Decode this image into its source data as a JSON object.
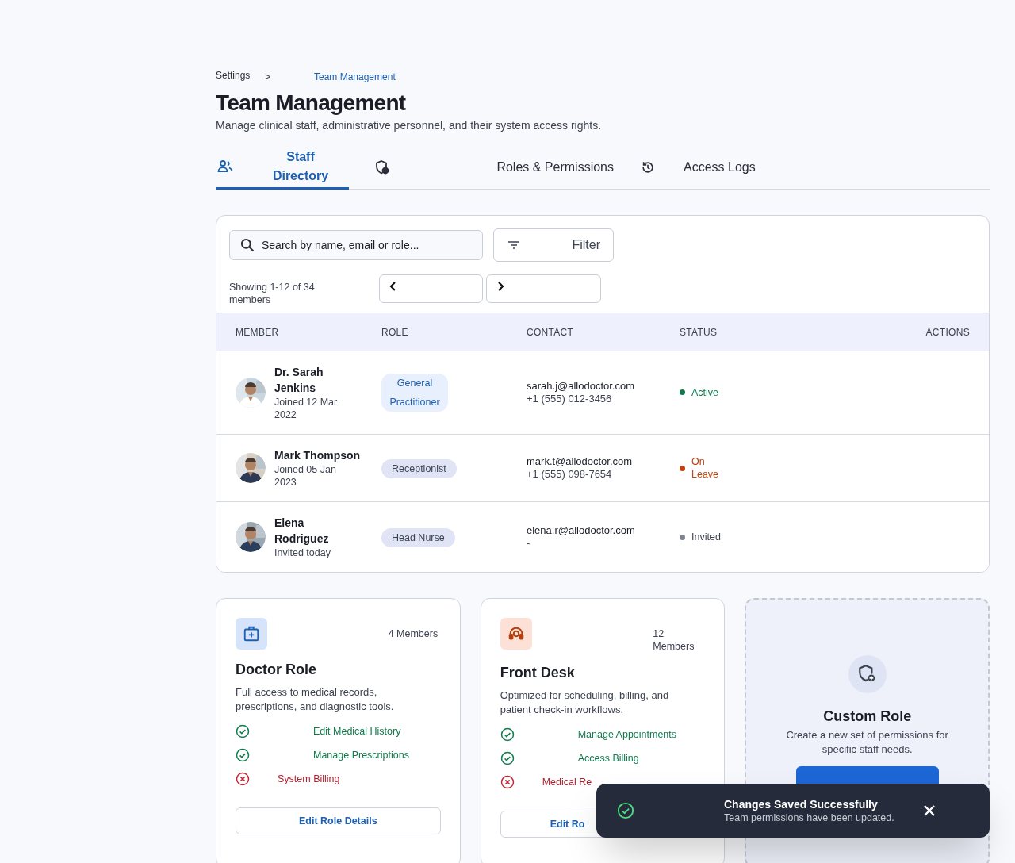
{
  "breadcrumb": {
    "items": [
      {
        "label": "Settings",
        "current": false
      },
      {
        "label": "Team Management",
        "current": true
      }
    ],
    "separator": ">"
  },
  "page": {
    "title": "Team Management",
    "subtitle": "Manage clinical staff, administrative personnel, and their system access rights."
  },
  "tabs": [
    {
      "label": "Staff Directory",
      "selected": true,
      "kind": "people"
    },
    {
      "label": "Roles & Permissions",
      "selected": false,
      "kind": "shield"
    },
    {
      "label": "Access Logs",
      "selected": false,
      "kind": "history"
    }
  ],
  "toolbar": {
    "search": {
      "placeholder": "Search by name, email or role..."
    },
    "filter_label": "Filter",
    "showing": "Showing 1-12 of 34 members"
  },
  "table": {
    "columns": [
      "MEMBER",
      "ROLE",
      "CONTACT",
      "STATUS",
      "ACTIONS"
    ],
    "rows": [
      {
        "name": "Dr. Sarah Jenkins",
        "joined": "Joined 12 Mar 2022",
        "role": "General Practitioner",
        "kind": "primary",
        "email": "sarah.j@allodoctor.com",
        "phone": "+1 (555) 012-3456",
        "status": "Active",
        "color": "#0f7a4b"
      },
      {
        "name": "Mark Thompson",
        "joined": "Joined 05 Jan 2023",
        "role": "Receptionist",
        "kind": "neutral",
        "email": "mark.t@allodoctor.com",
        "phone": "+1 (555) 098-7654",
        "status": "On Leave",
        "color": "#c2410c"
      },
      {
        "name": "Elena Rodriguez",
        "joined": "Invited today",
        "role": "Head Nurse",
        "kind": "neutral",
        "email": "elena.r@allodoctor.com",
        "phone": "-",
        "status": "Invited",
        "color": "#80848f"
      }
    ]
  },
  "role_cards": [
    {
      "kind": "doctor",
      "title": "Doctor Role",
      "members": "4 Members",
      "description": "Full access to medical records, prescriptions, and diagnostic tools.",
      "permissions": [
        {
          "label": "Edit Medical History",
          "granted": true
        },
        {
          "label": "Manage Prescriptions",
          "granted": true
        },
        {
          "label": "System Billing",
          "granted": false
        }
      ],
      "button": "Edit Role Details"
    },
    {
      "kind": "desk",
      "title": "Front Desk",
      "members": "12 Members",
      "description": "Optimized for scheduling, billing, and patient check-in workflows.",
      "permissions": [
        {
          "label": "Manage Appointments",
          "granted": true
        },
        {
          "label": "Access Billing",
          "granted": true
        },
        {
          "label": "Medical Re",
          "granted": false
        }
      ],
      "button": "Edit Ro"
    }
  ],
  "custom_role": {
    "title": "Custom Role",
    "description": "Create a new set of permissions for specific staff needs."
  },
  "toast": {
    "title": "Changes Saved Successfully",
    "message": "Team permissions have been updated."
  }
}
